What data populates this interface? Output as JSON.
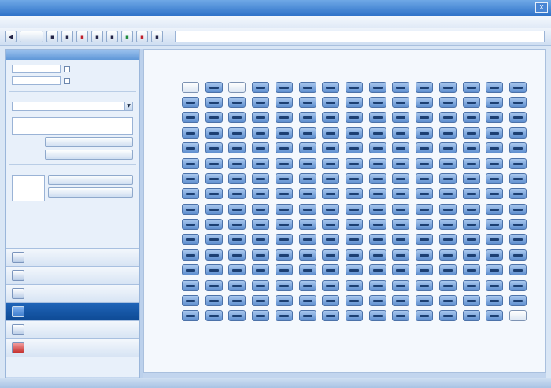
{
  "window": {
    "title": "",
    "close_glyph": "X"
  },
  "menu": {
    "items": [
      "",
      "",
      "",
      ""
    ]
  },
  "toolbar": {
    "buttons": [
      "",
      "",
      "",
      "",
      "",
      "",
      "",
      ""
    ]
  },
  "left_panel": {
    "header": "",
    "section1_label": "",
    "field1_label": "",
    "field2_label": "",
    "section2_label": "",
    "combo_value": "",
    "section3_label": "",
    "button1": "",
    "button2": "",
    "section4_label": "",
    "region_button1": "",
    "region_button2": ""
  },
  "nav": {
    "items": [
      {
        "label": "",
        "icon": "grid-icon",
        "active": false
      },
      {
        "label": "",
        "icon": "table-icon",
        "active": false
      },
      {
        "label": "",
        "icon": "chart-icon",
        "active": false
      },
      {
        "label": "",
        "icon": "plate-icon",
        "active": true
      },
      {
        "label": "",
        "icon": "settings-icon",
        "active": false
      },
      {
        "label": "",
        "icon": "stop-icon",
        "active": false
      }
    ]
  },
  "plate": {
    "rows": 16,
    "cols": 15,
    "light_cells": [
      [
        0,
        0
      ],
      [
        0,
        2
      ],
      [
        15,
        14
      ]
    ],
    "light_labels": {
      "0,0": "",
      "0,2": "",
      "15,14": ""
    }
  },
  "colors": {
    "accent": "#2f73c9",
    "active_nav": "#0e4a95",
    "well": "#5f8fcf"
  }
}
